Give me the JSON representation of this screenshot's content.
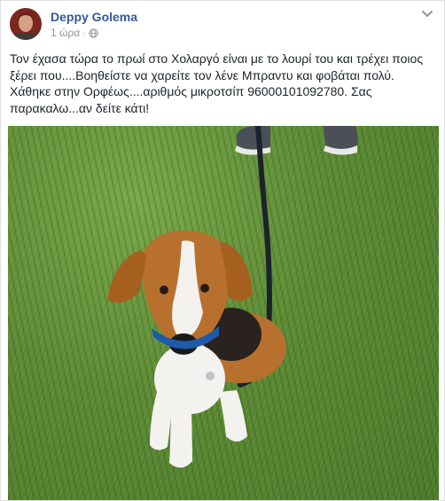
{
  "post": {
    "author": "Deppy Golema",
    "time": "1 ώρα",
    "separator": "·",
    "privacy_icon": "globe-icon",
    "options_icon": "chevron-down-icon",
    "text": "Τον έχασα τώρα το πρωί στο Χολαργό είναι με το λουρί του και τρέχει ποιος ξέρει που....Βοηθείστε να χαρείτε τον λένε Μπραντυ και φοβάται πολύ. Χάθηκε στην Ορφέως....αριθμός μικροτσίπ 96000101092780. Σας παρακαλω...αν δείτε κάτι!"
  },
  "colors": {
    "author_link": "#365899",
    "meta_text": "#90949c",
    "body_text": "#1d2129",
    "grass": "#5d8a36"
  }
}
